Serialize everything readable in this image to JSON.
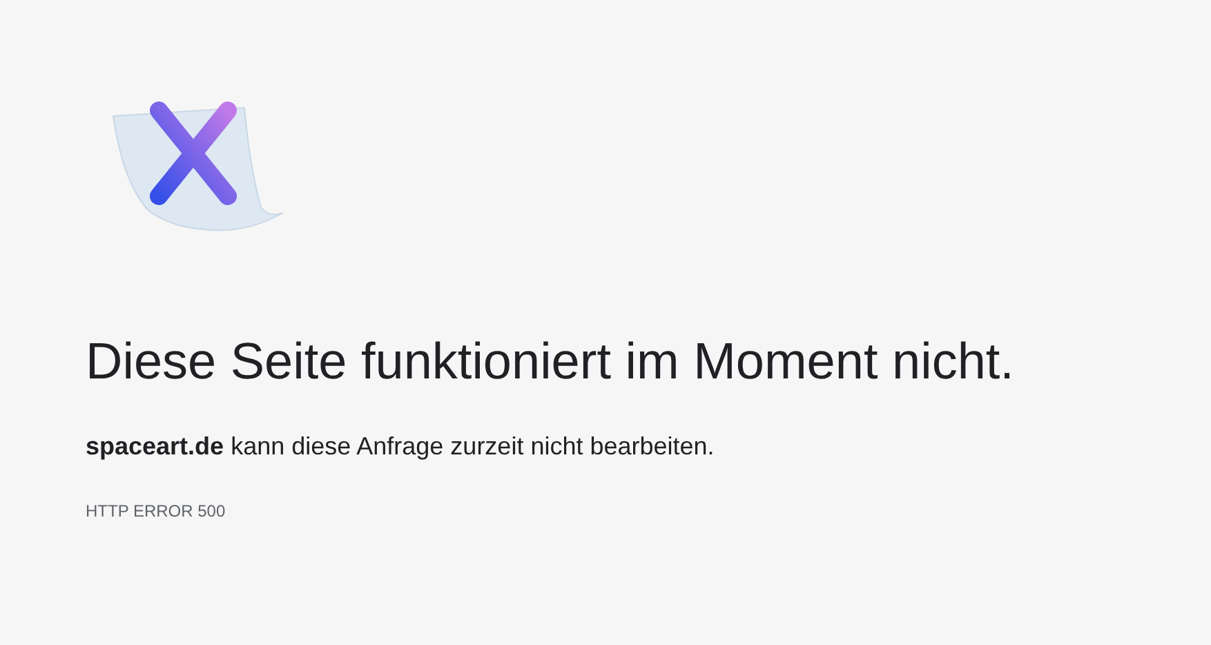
{
  "heading": "Diese Seite funktioniert im Moment nicht.",
  "message": "**spaceart.de** kann diese Anfrage zurzeit nicht bearbeiten.",
  "error_code": "HTTP ERROR 500"
}
